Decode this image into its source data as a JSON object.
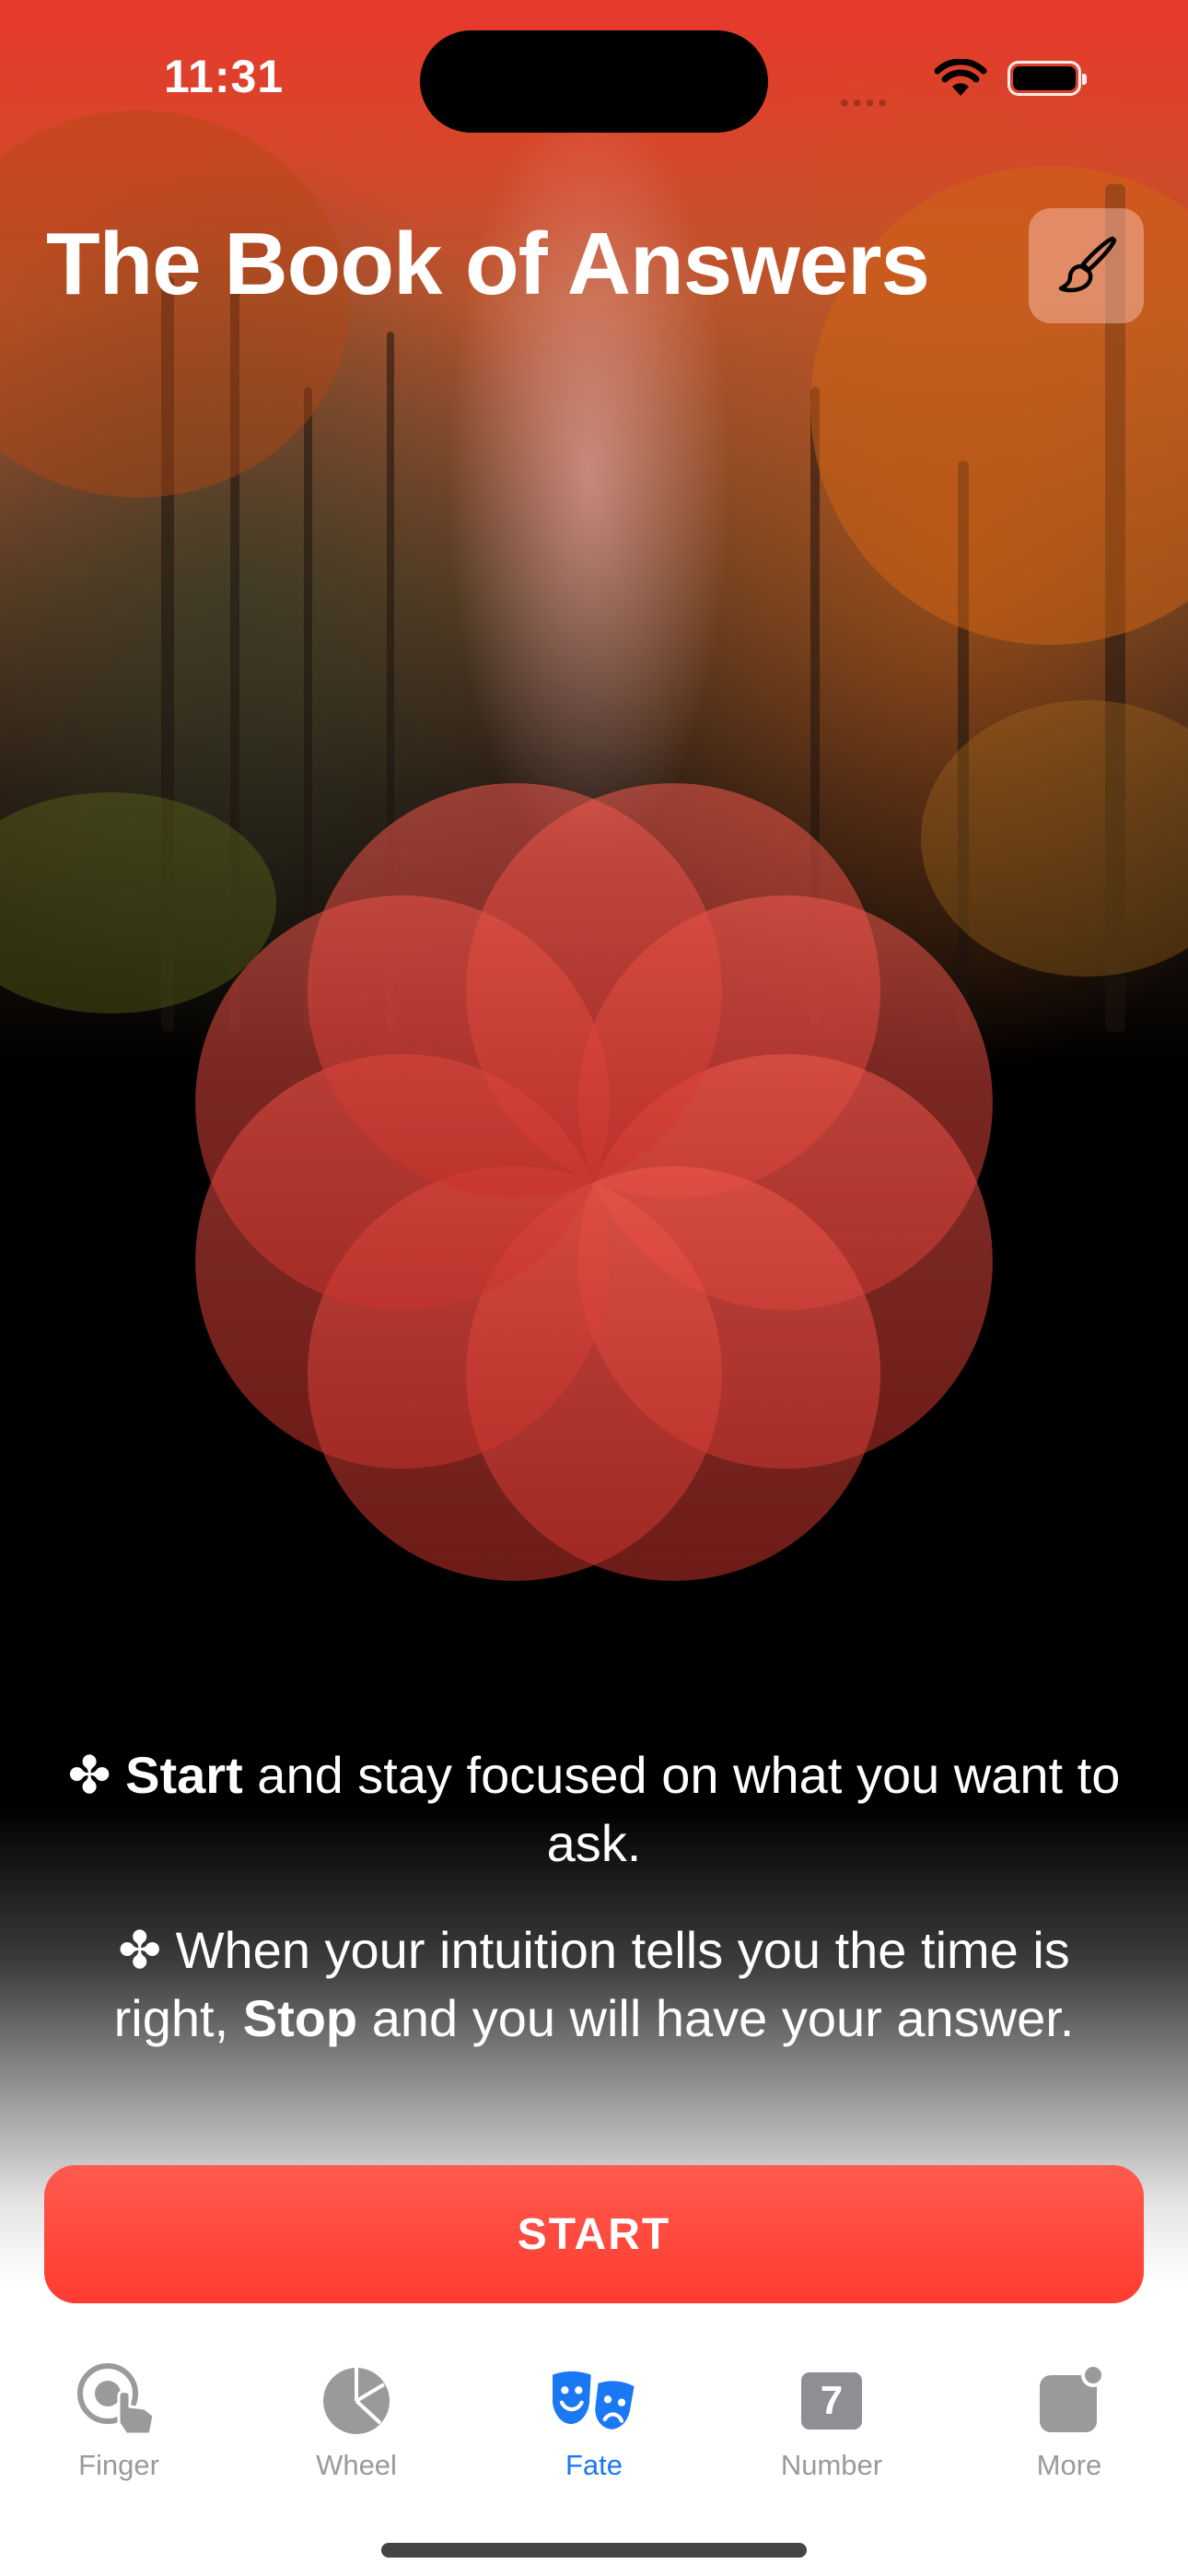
{
  "status_bar": {
    "time": "11:31"
  },
  "header": {
    "title": "The Book of Answers"
  },
  "instructions": {
    "line1": {
      "prefix": "✤ ",
      "bold": "Start",
      "rest": " and stay focused on what you want to ask."
    },
    "line2": {
      "prefix": "✤ When your intuition tells you the time is right, ",
      "bold": "Stop",
      "rest": " and you will have your answer."
    }
  },
  "start_button": {
    "label": "START"
  },
  "tabs": [
    {
      "label": "Finger",
      "icon": "finger-tap-icon",
      "active": false
    },
    {
      "label": "Wheel",
      "icon": "pie-wheel-icon",
      "active": false
    },
    {
      "label": "Fate",
      "icon": "theater-masks-icon",
      "active": true
    },
    {
      "label": "Number",
      "icon": "number-seven-icon",
      "number": "7",
      "active": false
    },
    {
      "label": "More",
      "icon": "more-badge-icon",
      "active": false
    }
  ],
  "colors": {
    "accent": "#ff3b30",
    "tab_active": "#1a78f2",
    "tab_inactive": "#9a9a9a",
    "petal": "#e8463c"
  }
}
